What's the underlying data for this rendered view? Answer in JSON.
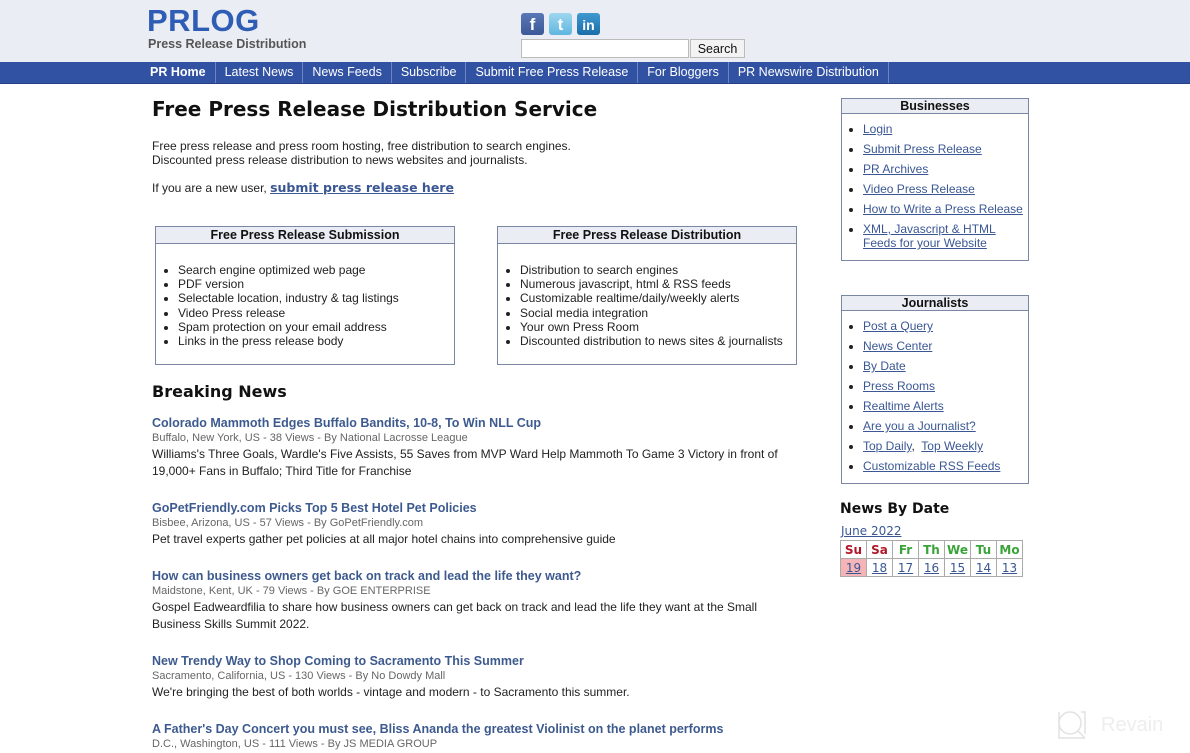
{
  "header": {
    "logo": "PRLOG",
    "tagline": "Press Release Distribution",
    "social": [
      {
        "name": "facebook-icon",
        "glyph": "f"
      },
      {
        "name": "twitter-icon",
        "glyph": "t"
      },
      {
        "name": "linkedin-icon",
        "glyph": "in"
      }
    ],
    "search": {
      "value": "",
      "placeholder": "",
      "button": "Search"
    }
  },
  "nav": {
    "items": [
      {
        "label": "PR Home",
        "active": true
      },
      {
        "label": "Latest News"
      },
      {
        "label": "News Feeds"
      },
      {
        "label": "Subscribe"
      },
      {
        "label": "Submit Free Press Release"
      },
      {
        "label": "For Bloggers"
      },
      {
        "label": "PR Newswire Distribution"
      }
    ]
  },
  "main": {
    "title": "Free Press Release Distribution Service",
    "intro_line1": "Free press release and press room hosting, free distribution to search engines.",
    "intro_line2": "Discounted press release distribution to news websites and journalists.",
    "new_user_text": "If you are a new user, ",
    "new_user_link": "submit press release here",
    "boxes": [
      {
        "title": "Free Press Release Submission",
        "items": [
          "Search engine optimized web page",
          "PDF version",
          "Selectable location, industry & tag listings",
          "Video Press release",
          "Spam protection on your email address",
          "Links in the press release body"
        ]
      },
      {
        "title": "Free Press Release Distribution",
        "items": [
          "Distribution to search engines",
          "Numerous javascript, html & RSS feeds",
          "Customizable realtime/daily/weekly alerts",
          "Social media integration",
          "Your own Press Room",
          "Discounted distribution to news sites & journalists"
        ]
      }
    ],
    "breaking_title": "Breaking News",
    "news": [
      {
        "title": "Colorado Mammoth Edges Buffalo Bandits, 10-8, To Win NLL Cup",
        "meta": "Buffalo, New York, US - 38 Views - By National Lacrosse League",
        "desc": "Williams's Three Goals, Wardle's Five Assists, 55 Saves from MVP Ward Help Mammoth To Game 3 Victory in front of 19,000+ Fans in Buffalo; Third Title for Franchise"
      },
      {
        "title": "GoPetFriendly.com Picks Top 5 Best Hotel Pet Policies",
        "meta": "Bisbee, Arizona, US - 57 Views - By GoPetFriendly.com",
        "desc": "Pet travel experts gather pet policies at all major hotel chains into comprehensive guide"
      },
      {
        "title": "How can business owners get back on track and lead the life they want?",
        "meta": "Maidstone, Kent, UK - 79 Views - By GOE ENTERPRISE",
        "desc": "Gospel Eadweardfilia to share how business owners can get back on track and lead the life they want at the Small Business Skills Summit 2022."
      },
      {
        "title": "New Trendy Way to Shop Coming to Sacramento This Summer",
        "meta": "Sacramento, California, US - 130 Views - By No Dowdy Mall",
        "desc": "We're bringing the best of both worlds - vintage and modern - to Sacramento this summer."
      },
      {
        "title": "A Father's Day Concert you must see, Bliss Ananda the greatest Violinist on the planet performs",
        "meta": "D.C., Washington, US - 111 Views - By JS MEDIA GROUP",
        "desc": ""
      }
    ]
  },
  "sidebar": {
    "businesses": {
      "title": "Businesses",
      "links": [
        "Login",
        "Submit Press Release",
        "PR Archives",
        "Video Press Release",
        "How to Write a Press Release",
        "XML, Javascript & HTML Feeds for your Website"
      ]
    },
    "journalists": {
      "title": "Journalists",
      "links": [
        "Post a Query",
        "News Center",
        "By Date",
        "Press Rooms",
        "Realtime Alerts",
        "Are you a Journalist?",
        "Top Daily",
        "Top Weekly",
        "Customizable RSS Feeds"
      ]
    },
    "news_by_date": {
      "title": "News By Date",
      "month": "June 2022",
      "days": [
        {
          "abbr": "Su",
          "date": "19",
          "weekend": true,
          "today": true
        },
        {
          "abbr": "Sa",
          "date": "18",
          "weekend": true
        },
        {
          "abbr": "Fr",
          "date": "17"
        },
        {
          "abbr": "Th",
          "date": "16"
        },
        {
          "abbr": "We",
          "date": "15"
        },
        {
          "abbr": "Tu",
          "date": "14"
        },
        {
          "abbr": "Mo",
          "date": "13"
        }
      ]
    }
  },
  "watermark": {
    "text": "Revain"
  }
}
